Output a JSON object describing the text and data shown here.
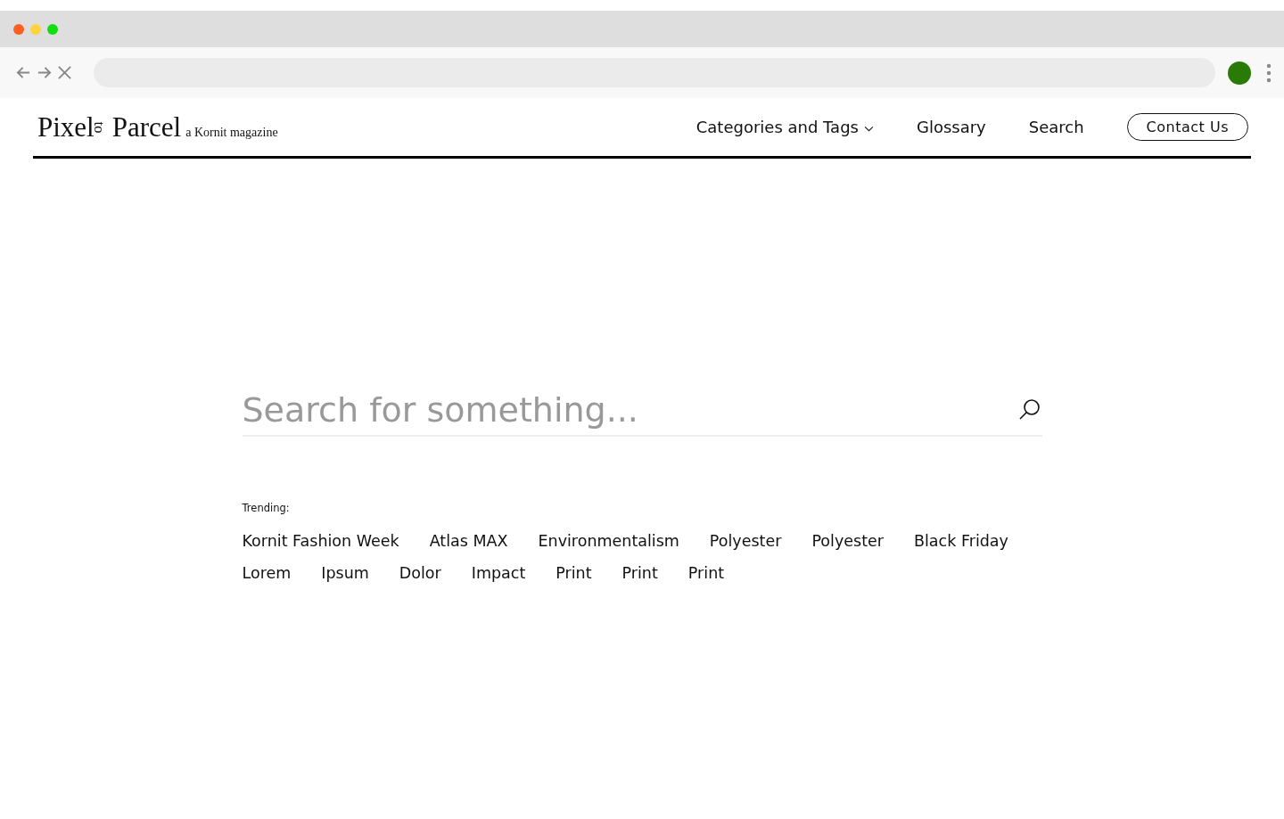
{
  "logo": {
    "first": "Pixel",
    "middle": "to",
    "last": "Parcel",
    "tagline": "a Kornit magazine"
  },
  "nav": [
    {
      "label": "Categories and Tags",
      "kind": "dropdown"
    },
    {
      "label": "Glossary",
      "kind": "link"
    },
    {
      "label": "Search",
      "kind": "link"
    },
    {
      "label": "Contact Us",
      "kind": "button"
    }
  ],
  "search": {
    "placeholder": "Search for something..."
  },
  "trending": {
    "label": "Trending:",
    "tags": [
      "Kornit Fashion Week",
      "Atlas MAX",
      "Environmentalism",
      "Polyester",
      "Polyester",
      "Black Friday",
      "Lorem",
      "Ipsum",
      "Dolor",
      "Impact",
      "Print",
      "Print",
      "Print"
    ]
  }
}
